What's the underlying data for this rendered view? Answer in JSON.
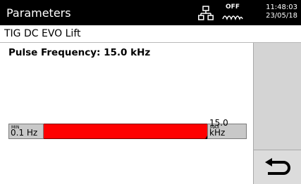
{
  "header": {
    "title": "Parameters",
    "network_icon": "network-icon",
    "status_icon": "wave-off-icon",
    "status_label": "OFF",
    "time": "11:48:03",
    "date": "23/05/18"
  },
  "process": {
    "label": "TIG  DC  EVO Lift"
  },
  "parameter": {
    "title": "Pulse Frequency: 15.0 kHz",
    "current_value": 15.0,
    "unit": "kHz",
    "min_tag": "MIN",
    "min_value": "0.1 Hz",
    "max_tag": "MAX",
    "max_value": "15.0 kHz",
    "fill_fraction": 1.0,
    "fill_color": "#ff0000"
  },
  "side_panel": {
    "back_icon": "return-arrow-icon"
  }
}
